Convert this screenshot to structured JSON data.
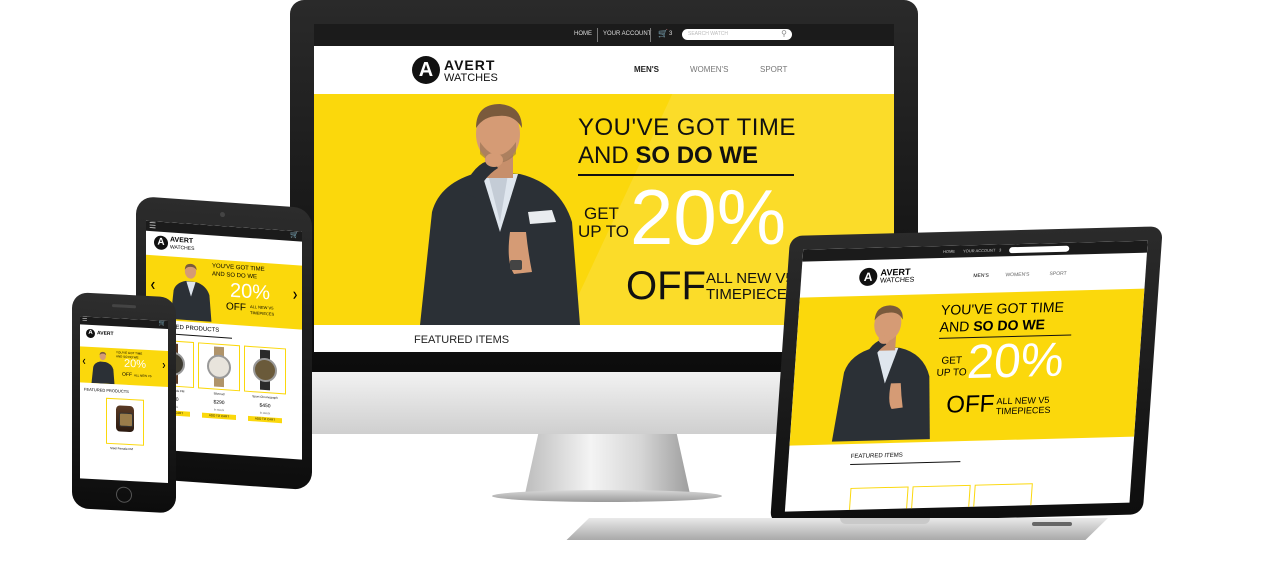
{
  "desktop": {
    "topnav": {
      "home": "HOME",
      "account": "YOUR ACCOUNT",
      "cart_count": "3",
      "search_placeholder": "SEARCH WATCH"
    },
    "logo": {
      "letter": "A",
      "line1": "AVERT",
      "line2": "WATCHES"
    },
    "nav": [
      "MEN'S",
      "WOMEN'S",
      "SPORT"
    ],
    "hero": {
      "headline1": "YOU'VE GOT TIME",
      "headline2a": "AND ",
      "headline2b": "SO DO WE",
      "get": "GET",
      "upto": "UP TO",
      "percent": "20%",
      "off": "OFF",
      "sub1": "ALL NEW V5",
      "sub2": "TIMEPIECES"
    },
    "featured": "FEATURED ITEMS"
  },
  "laptop": {
    "topnav": {
      "home": "HOME",
      "account": "YOUR ACCOUNT",
      "cart_count": "3"
    },
    "logo": {
      "letter": "A",
      "line1": "AVERT",
      "line2": "WATCHES"
    },
    "nav": [
      "MEN'S",
      "WOMEN'S",
      "SPORT"
    ],
    "hero": {
      "headline1": "YOU'VE GOT TIME",
      "headline2a": "AND ",
      "headline2b": "SO DO WE",
      "get": "GET",
      "upto": "UP TO",
      "percent": "20%",
      "off": "OFF",
      "sub1": "ALL NEW V5",
      "sub2": "TIMEPIECES"
    },
    "featured": "FEATURED ITEMS"
  },
  "tablet": {
    "logo": {
      "letter": "A",
      "line1": "AVERT",
      "line2": "WATCHES"
    },
    "hero": {
      "headline1": "YOU'VE GOT TIME",
      "headline2": "AND SO DO WE",
      "percent": "20%",
      "off": "OFF",
      "sub1": "ALL NEW V5",
      "sub2": "TIMEPIECES"
    },
    "featured": "FEATURED PRODUCTS",
    "products": [
      {
        "name": "Steel Female FM",
        "price": "$400",
        "stock": "In stock",
        "button": "ADD TO CART"
      },
      {
        "name": "Silverad",
        "price": "$290",
        "stock": "In stock",
        "button": "ADD TO CART"
      },
      {
        "name": "Sport Chronograph",
        "price": "$450",
        "stock": "In stock",
        "button": "ADD TO CART"
      }
    ]
  },
  "phone": {
    "logo": {
      "letter": "A",
      "line1": "AVERT"
    },
    "hero": {
      "headline1": "YOU'VE GOT TIME",
      "headline2": "AND SO DO WE",
      "percent": "20%",
      "off": "OFF",
      "sub": "ALL NEW V5"
    },
    "featured": "FEATURED PRODUCTS",
    "product_name": "Steel Female FM"
  },
  "colors": {
    "brand_yellow": "#fbd80c",
    "dark": "#1b1b1b"
  }
}
